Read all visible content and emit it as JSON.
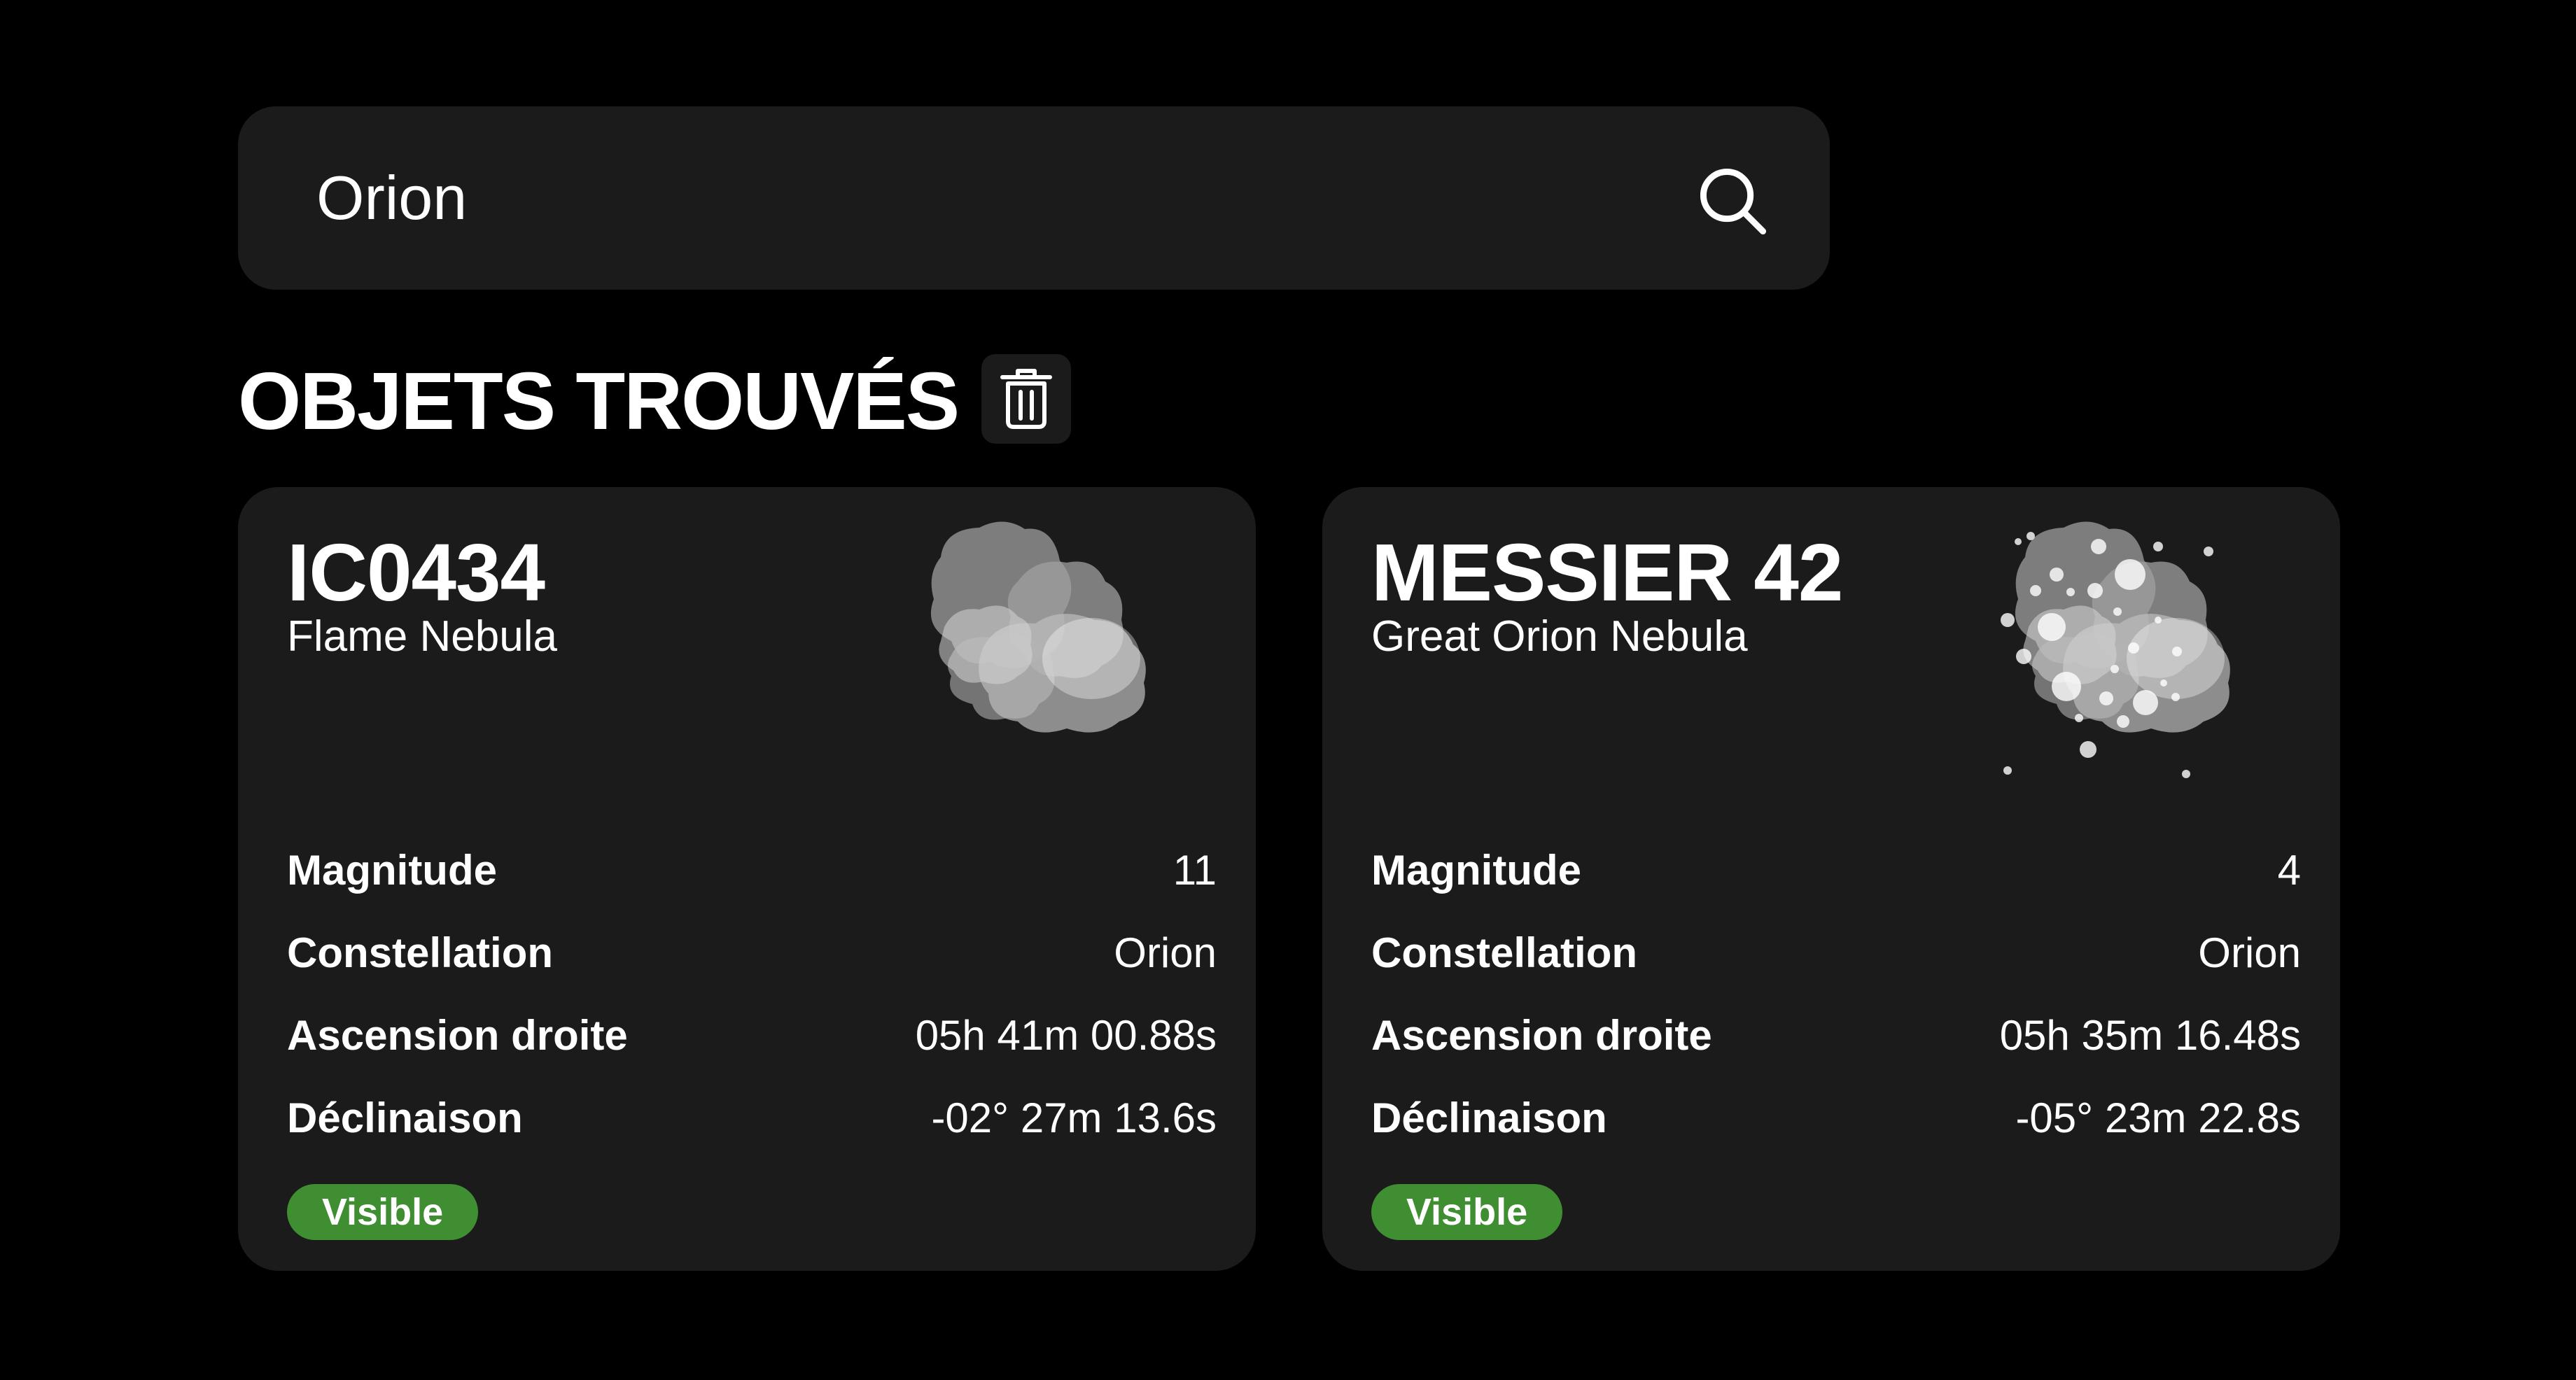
{
  "search": {
    "value": "Orion",
    "icon": "search-icon"
  },
  "section": {
    "title": "OBJETS TROUVÉS",
    "clear_icon": "trash-icon"
  },
  "results": [
    {
      "id": "IC0434",
      "name": "Flame Nebula",
      "image_icon": "nebula-icon",
      "properties": [
        {
          "label": "Magnitude",
          "value": "11"
        },
        {
          "label": "Constellation",
          "value": "Orion"
        },
        {
          "label": "Ascension droite",
          "value": "05h 41m 00.88s"
        },
        {
          "label": "Déclinaison",
          "value": "-02° 27m 13.6s"
        }
      ],
      "status": "Visible"
    },
    {
      "id": "MESSIER 42",
      "name": "Great Orion Nebula",
      "image_icon": "nebula-with-stars-icon",
      "properties": [
        {
          "label": "Magnitude",
          "value": "4"
        },
        {
          "label": "Constellation",
          "value": "Orion"
        },
        {
          "label": "Ascension droite",
          "value": "05h 35m 16.48s"
        },
        {
          "label": "Déclinaison",
          "value": "-05° 23m 22.8s"
        }
      ],
      "status": "Visible"
    }
  ],
  "colors": {
    "background": "#000000",
    "card": "#1b1b1b",
    "text": "#ffffff",
    "badge_visible": "#3f8f32"
  }
}
